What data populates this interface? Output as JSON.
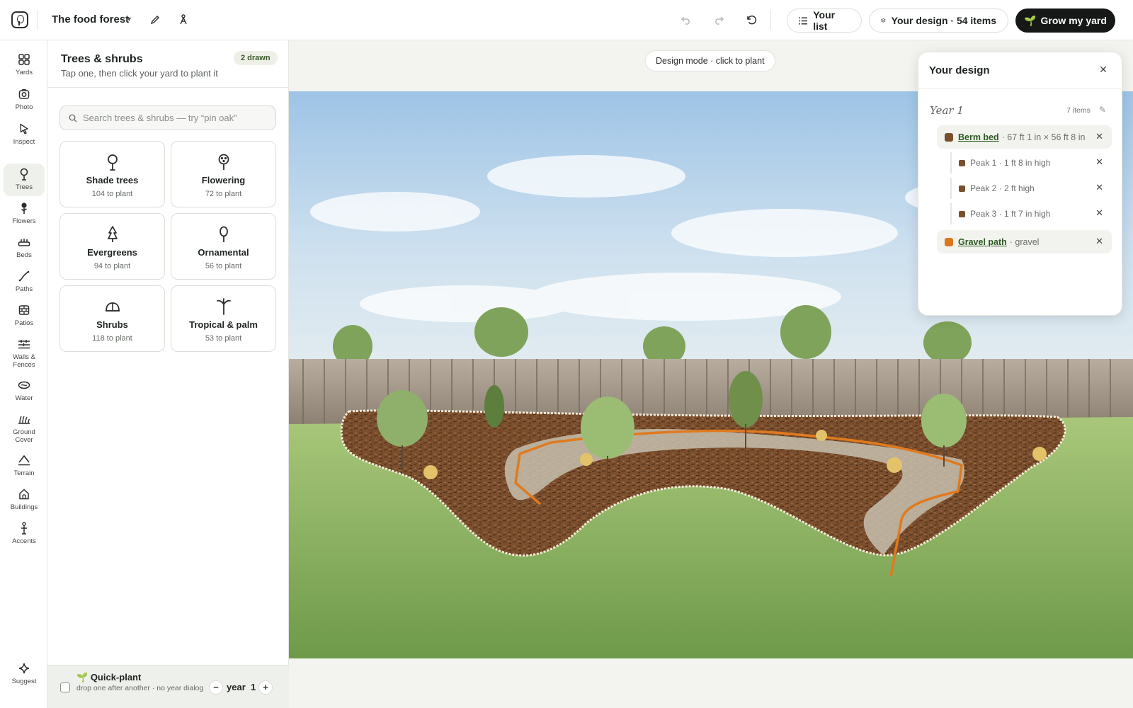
{
  "header": {
    "project_name": "The food forest",
    "your_list_label": "Your list",
    "your_design_label": "Your design ·",
    "your_design_count": "54 items",
    "grow_label": "Grow my yard"
  },
  "rail": {
    "items": [
      {
        "label": "Yards",
        "icon": "grid-icon"
      },
      {
        "label": "Photo",
        "icon": "camera-icon"
      },
      {
        "label": "Inspect",
        "icon": "cursor-icon"
      },
      {
        "label": "Trees",
        "icon": "tree-icon"
      },
      {
        "label": "Flowers",
        "icon": "flower-icon"
      },
      {
        "label": "Beds",
        "icon": "bed-icon"
      },
      {
        "label": "Paths",
        "icon": "path-icon"
      },
      {
        "label": "Patios",
        "icon": "patio-icon"
      },
      {
        "label": "Walls & Fences",
        "icon": "fence-icon"
      },
      {
        "label": "Water",
        "icon": "water-icon"
      },
      {
        "label": "Ground Cover",
        "icon": "grass-icon"
      },
      {
        "label": "Terrain",
        "icon": "terrain-icon"
      },
      {
        "label": "Buildings",
        "icon": "house-icon"
      },
      {
        "label": "Accents",
        "icon": "accent-icon"
      }
    ],
    "suggest_label": "Suggest"
  },
  "panel": {
    "title": "Trees & shrubs",
    "subtitle": "Tap one, then click your yard to plant it",
    "drawn_badge": "2 drawn",
    "search_placeholder": "Search trees & shrubs — try “pin oak”",
    "categories": [
      {
        "name": "Shade trees",
        "count": "104 to plant",
        "icon": "shade-tree-icon"
      },
      {
        "name": "Flowering",
        "count": "72 to plant",
        "icon": "flowering-tree-icon"
      },
      {
        "name": "Evergreens",
        "count": "94 to plant",
        "icon": "evergreen-icon"
      },
      {
        "name": "Ornamental",
        "count": "56 to plant",
        "icon": "ornamental-tree-icon"
      },
      {
        "name": "Shrubs",
        "count": "118 to plant",
        "icon": "shrub-icon"
      },
      {
        "name": "Tropical & palm",
        "count": "53 to plant",
        "icon": "palm-icon"
      }
    ],
    "quick_plant": {
      "title": "Quick-plant",
      "subtitle": "drop one after another · no year dialog",
      "year_label": "year",
      "year_value": "1",
      "checked": false
    }
  },
  "canvas": {
    "mode_label": "Design mode · click to plant"
  },
  "design": {
    "title": "Your design",
    "year_label": "Year 1",
    "items_count": "7 items",
    "layers": [
      {
        "name": "Berm bed",
        "meta": "· 67 ft 1 in × 56 ft 8 in",
        "color": "#7a4f2c"
      },
      {
        "name": "Gravel path",
        "meta": "· gravel",
        "color": "#d9771e"
      }
    ],
    "peaks": [
      {
        "text": "Peak 1 · 1 ft 8 in high",
        "color": "#7a4f2c"
      },
      {
        "text": "Peak 2 · 2 ft high",
        "color": "#7a4f2c"
      },
      {
        "text": "Peak 3 · 1 ft 7 in high",
        "color": "#7a4f2c"
      }
    ]
  },
  "colors": {
    "accent_dark": "#151816",
    "brand_green": "#2d5a22",
    "path_orange": "#e07a1f",
    "mulch_brown": "#7a4f2c"
  }
}
